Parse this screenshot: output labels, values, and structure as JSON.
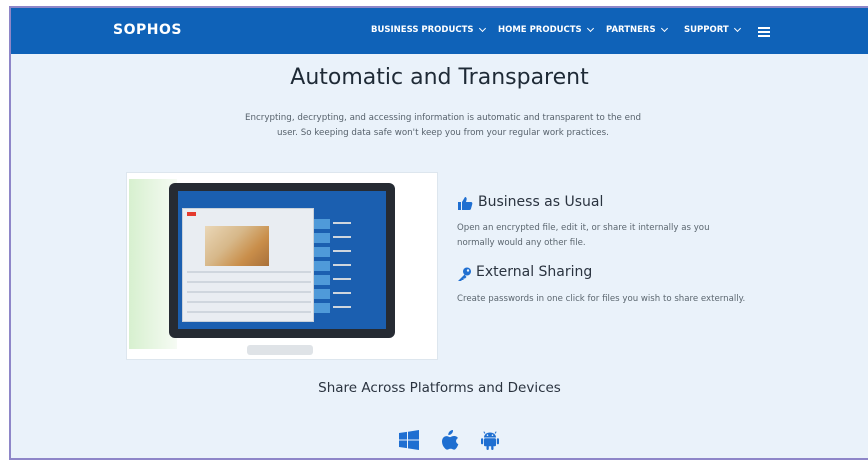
{
  "brand": {
    "logo_text": "SOPHOS",
    "accent": "#0f62b8"
  },
  "nav": {
    "items": [
      {
        "label": "BUSINESS PRODUCTS"
      },
      {
        "label": "HOME PRODUCTS"
      },
      {
        "label": "PARTNERS"
      },
      {
        "label": "SUPPORT"
      }
    ],
    "menu_icon": "hamburger-icon"
  },
  "hero": {
    "title": "Automatic and Transparent",
    "subtitle": "Encrypting, decrypting, and accessing information is automatic and transparent to the end user. So keeping data safe won't keep you from your regular work practices."
  },
  "features": [
    {
      "icon": "thumbs-up-icon",
      "title": "Business as Usual",
      "body": "Open an encrypted file, edit it, or share it internally as you normally would any other file."
    },
    {
      "icon": "key-icon",
      "title": "External Sharing",
      "body": "Create passwords in one click for files you wish to share externally."
    }
  ],
  "share": {
    "title": "Share Across Platforms and Devices",
    "platforms": [
      "windows-icon",
      "apple-icon",
      "android-icon"
    ]
  }
}
